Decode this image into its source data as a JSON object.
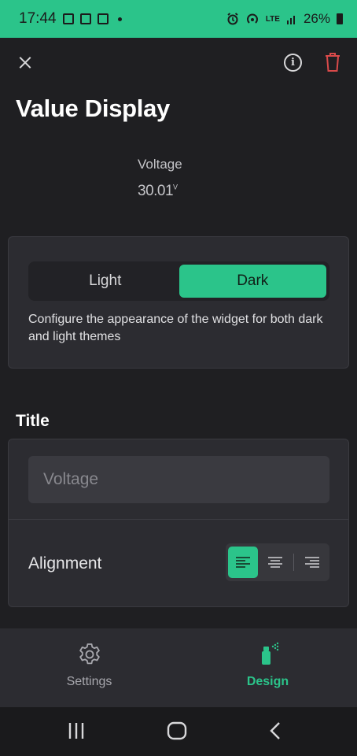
{
  "status_bar": {
    "time": "17:44",
    "lte_label": "LTE",
    "battery": "26%"
  },
  "header": {
    "title": "Value Display"
  },
  "preview": {
    "label": "Voltage",
    "value": "30.01",
    "unit": "V"
  },
  "theme": {
    "options": [
      "Light",
      "Dark"
    ],
    "selected": "Dark",
    "description": "Configure the appearance of the widget for both dark and light themes"
  },
  "title_section": {
    "heading": "Title",
    "input_value": "",
    "input_placeholder": "Voltage",
    "alignment_label": "Alignment",
    "alignment_options": [
      "left",
      "center",
      "right"
    ],
    "alignment_selected": "left"
  },
  "bottom_nav": {
    "items": [
      {
        "label": "Settings",
        "icon": "gear-icon",
        "active": false
      },
      {
        "label": "Design",
        "icon": "spray-can-icon",
        "active": true
      }
    ]
  },
  "colors": {
    "accent": "#2bc48a",
    "background": "#1f1f22",
    "card": "#2c2c31",
    "delete": "#d94a4a"
  }
}
